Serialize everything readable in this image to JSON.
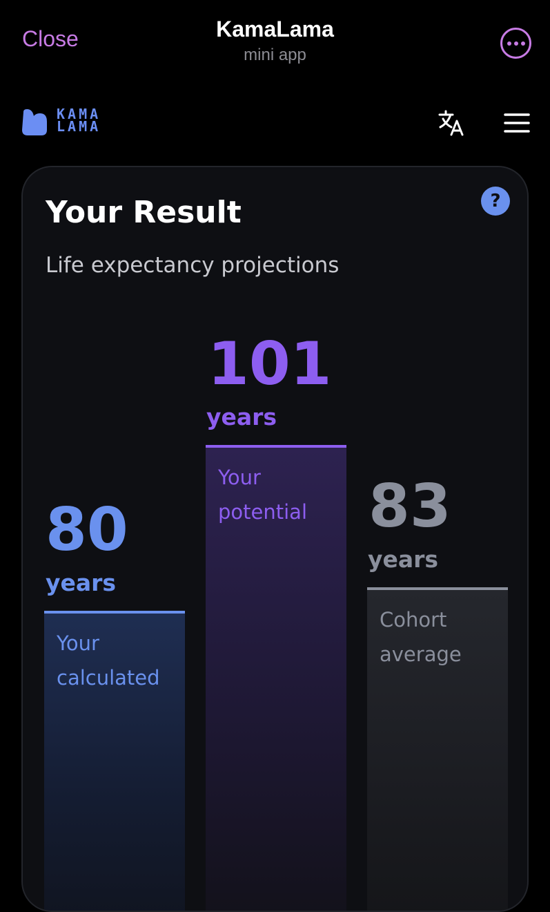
{
  "header": {
    "close_label": "Close",
    "title": "KamaLama",
    "subtitle": "mini app"
  },
  "appbar": {
    "logo_line1": "KAMA",
    "logo_line2": "LAMA"
  },
  "card": {
    "title": "Your Result",
    "subtitle": "Life expectancy projections",
    "help_label": "?"
  },
  "bars": [
    {
      "value": "80",
      "unit": "years",
      "label_line1": "Your",
      "label_line2": "calculated",
      "color": "#6a91ee"
    },
    {
      "value": "101",
      "unit": "years",
      "label_line1": "Your",
      "label_line2": "potential",
      "color": "#8d5ef0"
    },
    {
      "value": "83",
      "unit": "years",
      "label_line1": "Cohort",
      "label_line2": "average",
      "color": "#8a8f9c"
    }
  ],
  "colors": {
    "accent_close": "#c77be4",
    "accent_blue": "#6a91ee",
    "accent_purple": "#8d5ef0",
    "neutral_gray": "#8a8f9c"
  }
}
